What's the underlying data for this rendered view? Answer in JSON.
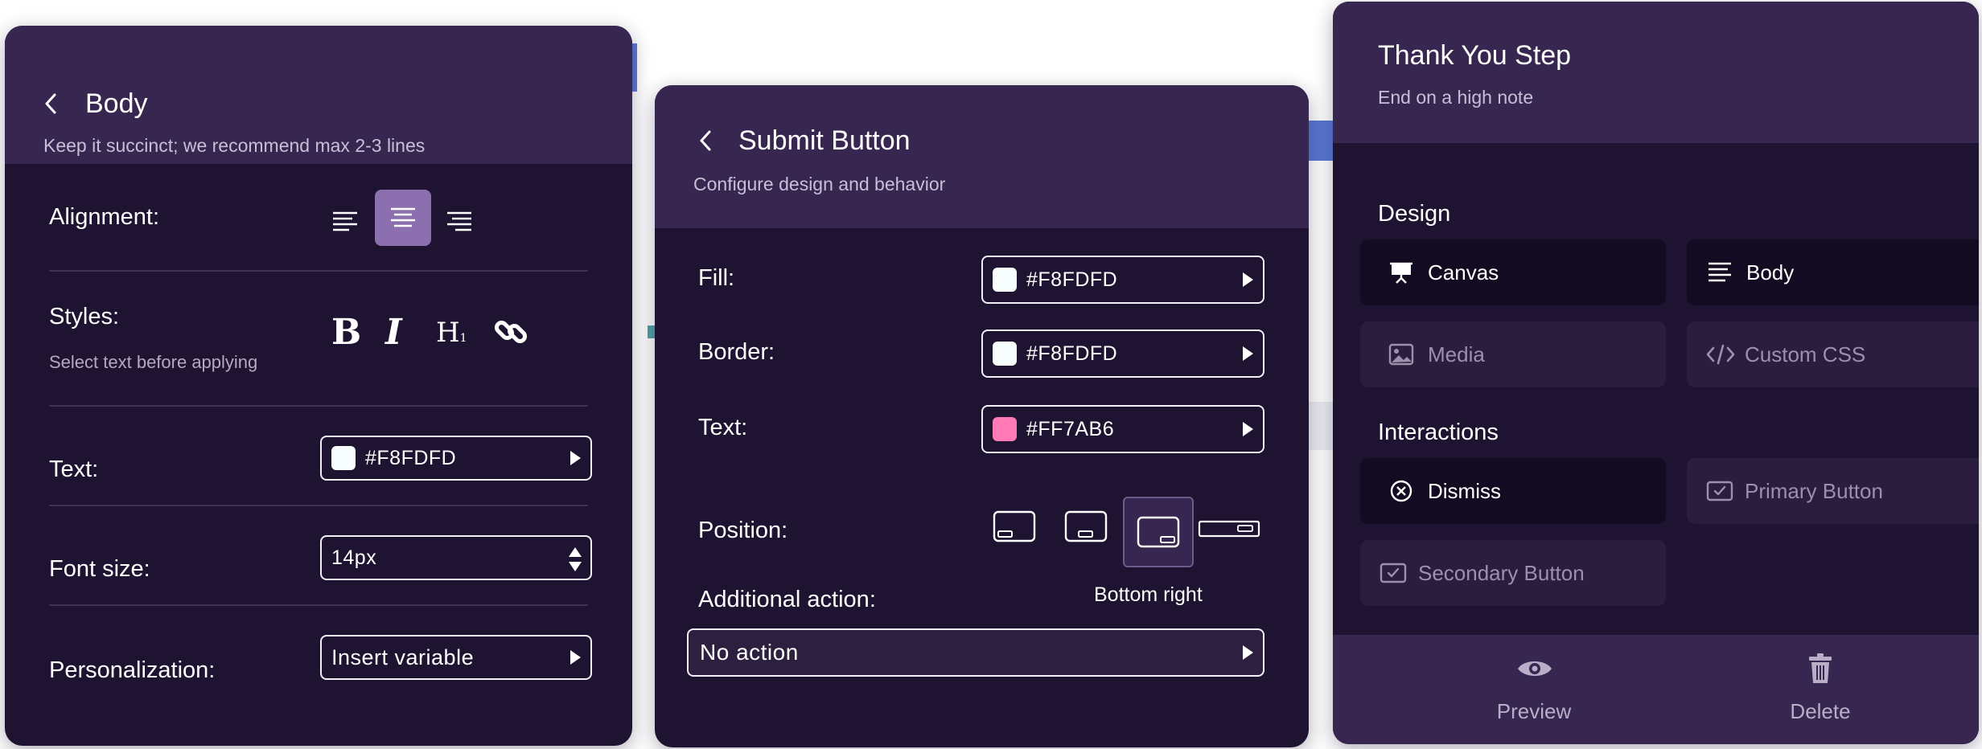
{
  "colors": {
    "panel_bg": "#1e1330",
    "header_bg": "#37264f",
    "accent": "#8c6fae",
    "fill_swatch": "#F8FDFD",
    "text_swatch": "#FF7AB6"
  },
  "body_panel": {
    "title": "Body",
    "subtitle": "Keep it succinct; we recommend max 2-3 lines",
    "alignment_label": "Alignment:",
    "alignment_options": [
      "align-left",
      "align-center",
      "align-right"
    ],
    "alignment_selected": "align-center",
    "styles_label": "Styles:",
    "styles_hint": "Select text before applying",
    "style_tools": [
      "bold",
      "italic",
      "heading",
      "link"
    ],
    "heading_glyph": "H",
    "heading_sub": "1",
    "text_label": "Text:",
    "text_color": "#F8FDFD",
    "font_size_label": "Font size:",
    "font_size_value": "14px",
    "personalization_label": "Personalization:",
    "personalization_value": "Insert variable"
  },
  "submit_panel": {
    "title": "Submit Button",
    "subtitle": "Configure design and behavior",
    "fill_label": "Fill:",
    "fill_value": "#F8FDFD",
    "border_label": "Border:",
    "border_value": "#F8FDFD",
    "text_label": "Text:",
    "text_value": "#FF7AB6",
    "position_label": "Position:",
    "position_options": [
      "bottom-left",
      "bottom-center",
      "bottom-right",
      "full-width"
    ],
    "position_selected": "bottom-right",
    "position_caption": "Bottom right",
    "additional_label": "Additional action:",
    "additional_value": "No action"
  },
  "step_panel": {
    "title": "Thank You Step",
    "subtitle": "End on a high note",
    "design_heading": "Design",
    "design_items": [
      {
        "label": "Canvas",
        "icon": "canvas-icon",
        "active": true
      },
      {
        "label": "Body",
        "icon": "body-text-icon",
        "active": true
      },
      {
        "label": "Media",
        "icon": "image-icon",
        "active": false
      },
      {
        "label": "Custom CSS",
        "icon": "code-icon",
        "active": false
      }
    ],
    "interactions_heading": "Interactions",
    "interaction_items": [
      {
        "label": "Dismiss",
        "icon": "dismiss-icon",
        "active": true
      },
      {
        "label": "Primary Button",
        "icon": "checkbox-icon",
        "active": false
      },
      {
        "label": "Secondary Button",
        "icon": "checkbox-icon",
        "active": false
      }
    ],
    "preview_label": "Preview",
    "delete_label": "Delete"
  }
}
